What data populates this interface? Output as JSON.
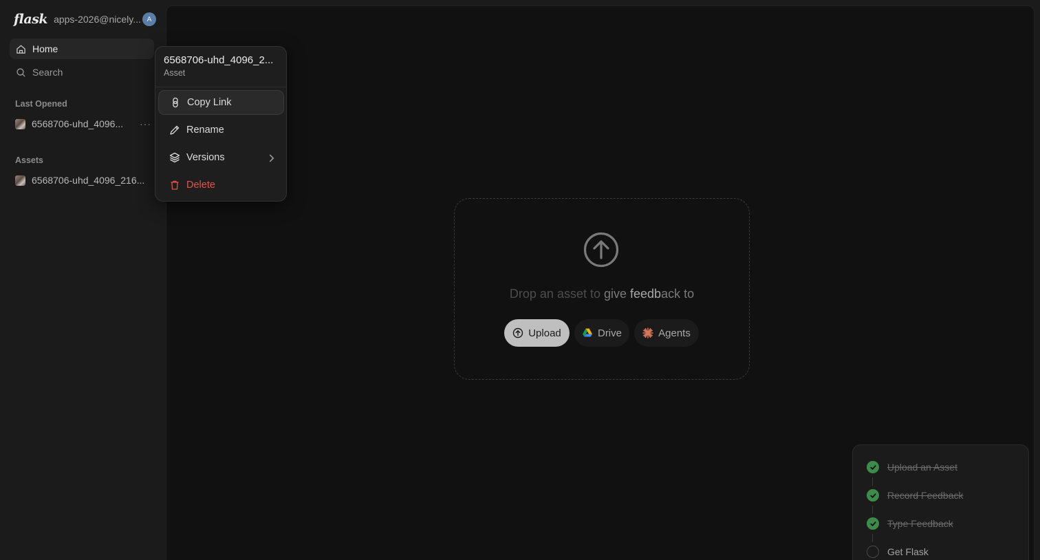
{
  "sidebar": {
    "logo": "flask",
    "workspace": "apps-2026@nicely...",
    "avatar_initial": "A",
    "nav": [
      {
        "label": "Home",
        "icon": "home-icon"
      },
      {
        "label": "Search",
        "icon": "search-icon"
      }
    ],
    "last_opened_label": "Last Opened",
    "last_opened_items": [
      {
        "label": "6568706-uhd_4096..."
      }
    ],
    "more_label": "···",
    "assets_label": "Assets",
    "asset_items": [
      {
        "label": "6568706-uhd_4096_216..."
      }
    ]
  },
  "context_menu": {
    "title": "6568706-uhd_4096_2...",
    "subtitle": "Asset",
    "items": [
      {
        "label": "Copy Link",
        "icon": "link-icon"
      },
      {
        "label": "Rename",
        "icon": "pencil-icon"
      },
      {
        "label": "Versions",
        "icon": "layers-icon"
      },
      {
        "label": "Delete",
        "icon": "trash-icon"
      }
    ]
  },
  "dropzone": {
    "text_part1": "Drop an asset to ",
    "text_part2": "give ",
    "text_part3": "feedb",
    "text_part4": "ack to",
    "buttons": {
      "upload": "Upload",
      "drive": "Drive",
      "agents": "Agents"
    }
  },
  "checklist": {
    "items": [
      {
        "label": "Upload an Asset",
        "done": true
      },
      {
        "label": "Record Feedback",
        "done": true
      },
      {
        "label": "Type Feedback",
        "done": true
      },
      {
        "label": "Get Flask",
        "done": false
      }
    ]
  },
  "colors": {
    "background": "#1b1b1b",
    "main_panel": "#111111",
    "danger": "#e5534b",
    "success": "#3d8b4a",
    "upload_button": "#bfbfbf"
  }
}
